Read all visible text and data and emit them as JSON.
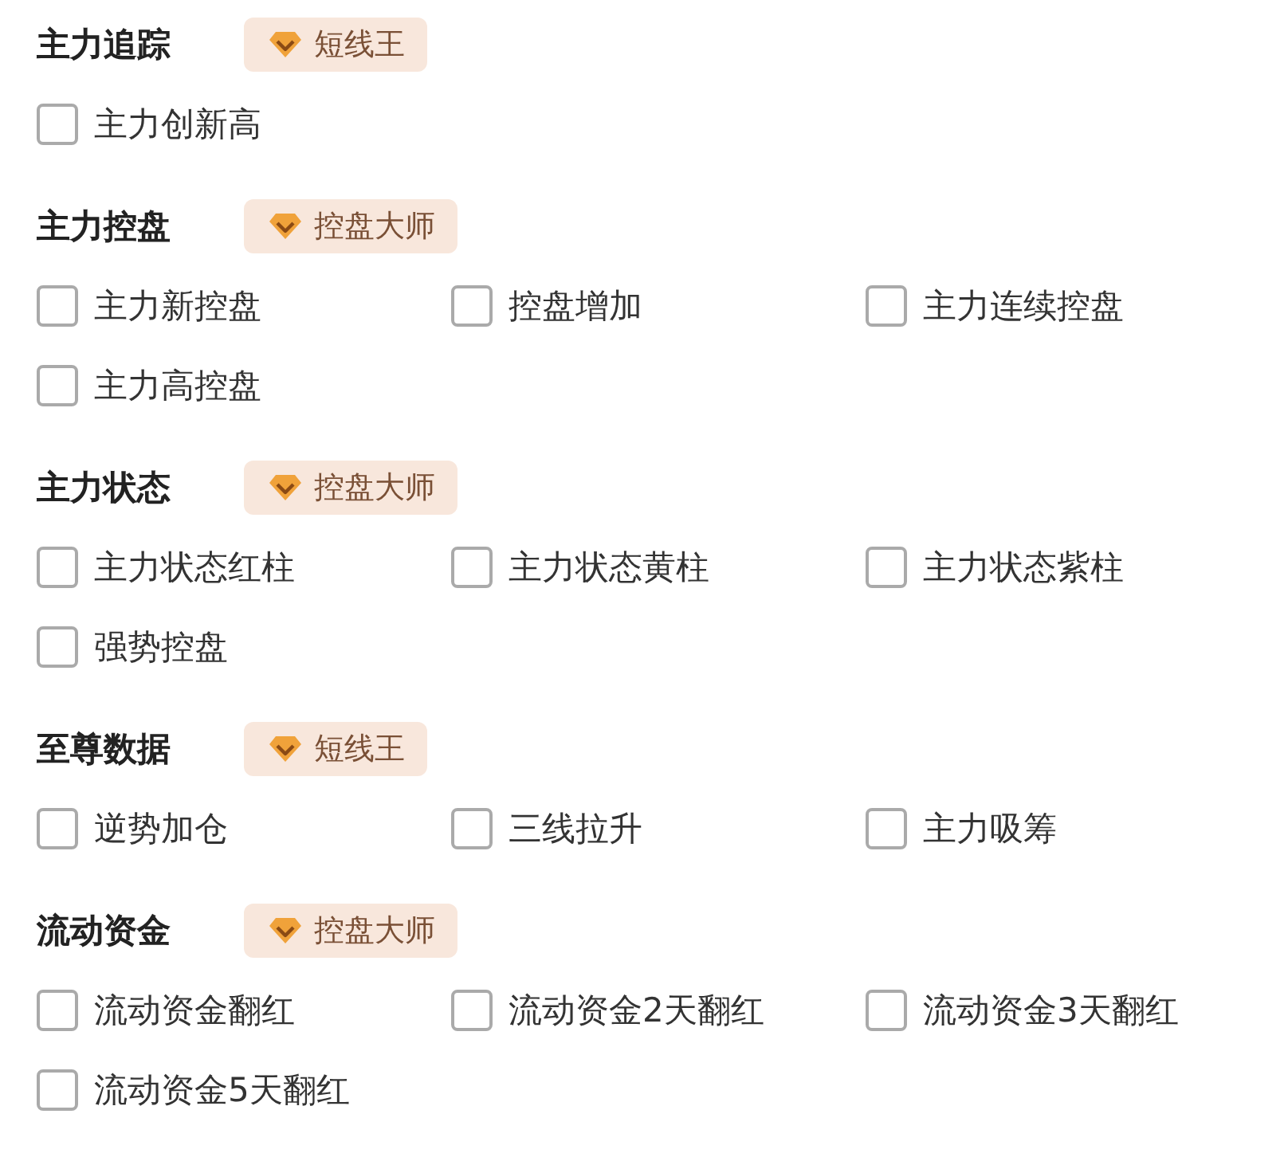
{
  "sections": [
    {
      "title": "主力追踪",
      "badge": "短线王",
      "options": [
        {
          "label": "主力创新高",
          "checked": false
        }
      ]
    },
    {
      "title": "主力控盘",
      "badge": "控盘大师",
      "options": [
        {
          "label": "主力新控盘",
          "checked": false
        },
        {
          "label": "控盘增加",
          "checked": false
        },
        {
          "label": "主力连续控盘",
          "checked": false
        },
        {
          "label": "主力高控盘",
          "checked": false
        }
      ]
    },
    {
      "title": "主力状态",
      "badge": "控盘大师",
      "options": [
        {
          "label": "主力状态红柱",
          "checked": false
        },
        {
          "label": "主力状态黄柱",
          "checked": false
        },
        {
          "label": "主力状态紫柱",
          "checked": false
        },
        {
          "label": "强势控盘",
          "checked": false
        }
      ]
    },
    {
      "title": "至尊数据",
      "badge": "短线王",
      "options": [
        {
          "label": "逆势加仓",
          "checked": false
        },
        {
          "label": "三线拉升",
          "checked": false
        },
        {
          "label": "主力吸筹",
          "checked": false
        }
      ]
    },
    {
      "title": "流动资金",
      "badge": "控盘大师",
      "options": [
        {
          "label": "流动资金翻红",
          "checked": false
        },
        {
          "label": "流动资金2天翻红",
          "checked": false
        },
        {
          "label": "流动资金3天翻红",
          "checked": false
        },
        {
          "label": "流动资金5天翻红",
          "checked": false
        }
      ]
    }
  ]
}
